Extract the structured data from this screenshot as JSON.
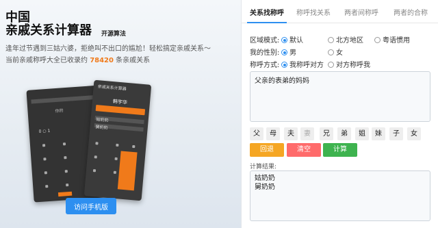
{
  "header": {
    "title_line1": "中国",
    "title_line2": "亲戚关系计算器",
    "open_algo": "开源算法",
    "desc_line1": "逢年过节遇到三姑六婆，拒绝叫不出口的尴尬！轻松搞定亲戚关系～",
    "desc_prefix": "当前亲戚称呼大全已收录约",
    "desc_count": "78420",
    "desc_suffix": "条亲戚关系"
  },
  "mobile_button": "访问手机版",
  "tabs": [
    {
      "label": "关系找称呼",
      "active": true
    },
    {
      "label": "称呼找关系",
      "active": false
    },
    {
      "label": "两者间称呼",
      "active": false
    },
    {
      "label": "两者的合称",
      "active": false
    }
  ],
  "options": {
    "region": {
      "label": "区域模式:",
      "choices": [
        {
          "label": "默认",
          "selected": true
        },
        {
          "label": "北方地区",
          "selected": false
        },
        {
          "label": "粤语惯用",
          "selected": false
        }
      ]
    },
    "gender": {
      "label": "我的性别:",
      "choices": [
        {
          "label": "男",
          "selected": true
        },
        {
          "label": "女",
          "selected": false
        }
      ]
    },
    "direction": {
      "label": "称呼方式:",
      "choices": [
        {
          "label": "我称呼对方",
          "selected": true
        },
        {
          "label": "对方称呼我",
          "selected": false
        }
      ]
    }
  },
  "input_value": "父亲的表弟的妈妈",
  "keys": [
    {
      "label": "父",
      "enabled": true
    },
    {
      "label": "母",
      "enabled": true
    },
    {
      "label": "夫",
      "enabled": true
    },
    {
      "label": "妻",
      "enabled": false
    },
    {
      "label": "兄",
      "enabled": true
    },
    {
      "label": "弟",
      "enabled": true
    },
    {
      "label": "姐",
      "enabled": true
    },
    {
      "label": "妹",
      "enabled": true
    },
    {
      "label": "子",
      "enabled": true
    },
    {
      "label": "女",
      "enabled": true
    }
  ],
  "actions": {
    "back": "回退",
    "clear": "清空",
    "calc": "计算"
  },
  "result_label": "计算结果:",
  "results": [
    "姑奶奶",
    "舅奶奶"
  ],
  "colors": {
    "accent": "#2d8ff0",
    "orange": "#f07a1a",
    "back_button": "#f5a623",
    "clear_button": "#ff6b6b",
    "calc_button": "#3eb34f"
  },
  "phone_screens": {
    "front_header": "亲戚关系计算器",
    "front_name": "韩宇华",
    "row1": "姑奶奶",
    "row2": "舅奶奶"
  }
}
